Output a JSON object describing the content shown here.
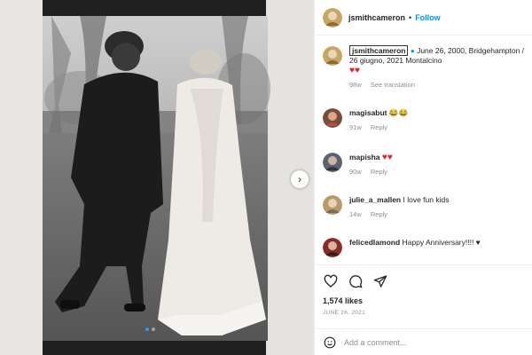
{
  "post": {
    "author": "jsmithcameron",
    "follow_label": "Follow",
    "separator": "•",
    "caption": {
      "username": "jsmithcameron",
      "text": "June 26, 2000, Bridgehampton / 26 giugno, 2021 Montalcino",
      "emoji": "♥♥",
      "age": "98w",
      "translate_label": "See translation"
    },
    "comments": [
      {
        "user": "magisabut",
        "text": "😂😂",
        "age": "91w",
        "reply_label": "Reply"
      },
      {
        "user": "mapisha",
        "text": "♥♥",
        "age": "90w",
        "reply_label": "Reply"
      },
      {
        "user": "julie_a_mallen",
        "text": "I love fun kids",
        "age": "14w",
        "reply_label": "Reply"
      },
      {
        "user": "felicedlamond",
        "text": "Happy Anniversary!!!! ♥",
        "age": "",
        "reply_label": ""
      }
    ],
    "likes": "1,574 likes",
    "date": "JUNE 26, 2021",
    "add_comment_placeholder": "Add a comment..."
  },
  "colors": {
    "accent": "#0095f6",
    "heart": "#ed1c24",
    "muted": "#8e8e8e"
  },
  "icons": {
    "like": "heart-outline-icon",
    "comment": "speech-bubble-icon",
    "share": "paper-plane-icon",
    "emoji": "smiley-icon",
    "verified": "verified-badge-icon",
    "next": "chevron-right-icon"
  },
  "carousel": {
    "current": 1,
    "total": 2
  }
}
